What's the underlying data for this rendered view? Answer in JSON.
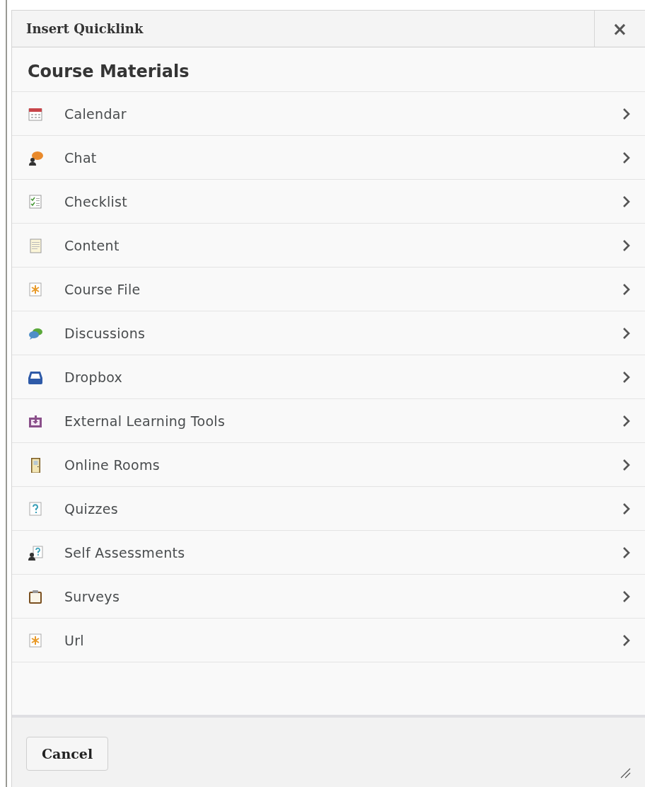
{
  "dialog": {
    "title": "Insert Quicklink",
    "close": "×"
  },
  "section": {
    "heading": "Course Materials"
  },
  "items": [
    {
      "label": "Calendar",
      "kind": "calendar"
    },
    {
      "label": "Chat",
      "kind": "chat"
    },
    {
      "label": "Checklist",
      "kind": "checklist"
    },
    {
      "label": "Content",
      "kind": "content"
    },
    {
      "label": "Course File",
      "kind": "file"
    },
    {
      "label": "Discussions",
      "kind": "discussions"
    },
    {
      "label": "Dropbox",
      "kind": "dropbox"
    },
    {
      "label": "External Learning Tools",
      "kind": "external"
    },
    {
      "label": "Online Rooms",
      "kind": "room"
    },
    {
      "label": "Quizzes",
      "kind": "quiz"
    },
    {
      "label": "Self Assessments",
      "kind": "self"
    },
    {
      "label": "Surveys",
      "kind": "survey"
    },
    {
      "label": "Url",
      "kind": "file"
    }
  ],
  "footer": {
    "buttons": [
      "Cancel"
    ]
  }
}
